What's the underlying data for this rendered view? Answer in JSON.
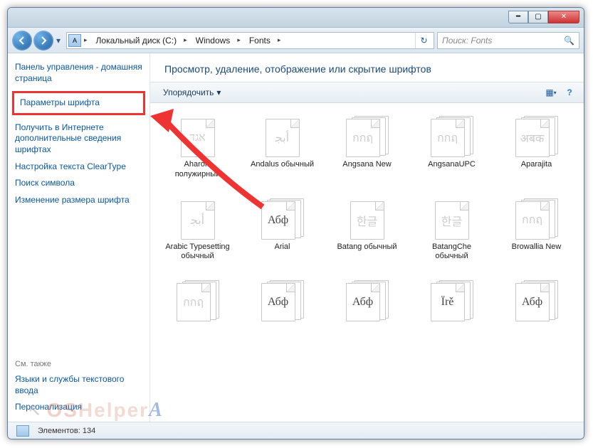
{
  "breadcrumb": {
    "seg1": "Локальный диск (C:)",
    "seg2": "Windows",
    "seg3": "Fonts"
  },
  "search": {
    "placeholder": "Поиск: Fonts"
  },
  "sidebar": {
    "home": "Панель управления - домашняя страница",
    "font_settings": "Параметры шрифта",
    "online_info": "Получить в Интернете дополнительные сведения шрифтах",
    "cleartype": "Настройка текста ClearType",
    "find_symbol": "Поиск символа",
    "resize": "Изменение размера шрифта",
    "see_also": "См. также",
    "lang_services": "Языки и службы текстового ввода",
    "personalization": "Персонализация"
  },
  "header": {
    "title": "Просмотр, удаление, отображение или скрытие шрифтов"
  },
  "toolbar": {
    "organize": "Упорядочить"
  },
  "fonts": [
    {
      "label": "Aharoni полужирный",
      "preview": "אגד",
      "faded": true,
      "stack": false
    },
    {
      "label": "Andalus обычный",
      "preview": "أﺑﺠ",
      "faded": true,
      "stack": false
    },
    {
      "label": "Angsana New",
      "preview": "กกฤ",
      "faded": true,
      "stack": true
    },
    {
      "label": "AngsanaUPC",
      "preview": "กกฤ",
      "faded": true,
      "stack": true
    },
    {
      "label": "Aparajita",
      "preview": "अबक",
      "faded": true,
      "stack": true
    },
    {
      "label": "Arabic Typesetting обычный",
      "preview": "أﺑﺠ",
      "faded": true,
      "stack": false
    },
    {
      "label": "Arial",
      "preview": "Абф",
      "faded": false,
      "stack": true
    },
    {
      "label": "Batang обычный",
      "preview": "한글",
      "faded": true,
      "stack": false
    },
    {
      "label": "BatangChe обычный",
      "preview": "한글",
      "faded": true,
      "stack": false
    },
    {
      "label": "Browallia New",
      "preview": "กกฤ",
      "faded": true,
      "stack": true
    },
    {
      "label": "",
      "preview": "กกฤ",
      "faded": true,
      "stack": true
    },
    {
      "label": "",
      "preview": "Абф",
      "faded": false,
      "stack": true
    },
    {
      "label": "",
      "preview": "Абф",
      "faded": false,
      "stack": true
    },
    {
      "label": "",
      "preview": "Ïrě",
      "faded": false,
      "stack": true
    },
    {
      "label": "",
      "preview": "Абф",
      "faded": false,
      "stack": true
    }
  ],
  "status": {
    "elements_label": "Элементов:",
    "count": "134"
  },
  "watermark": {
    "text": "Helper"
  }
}
